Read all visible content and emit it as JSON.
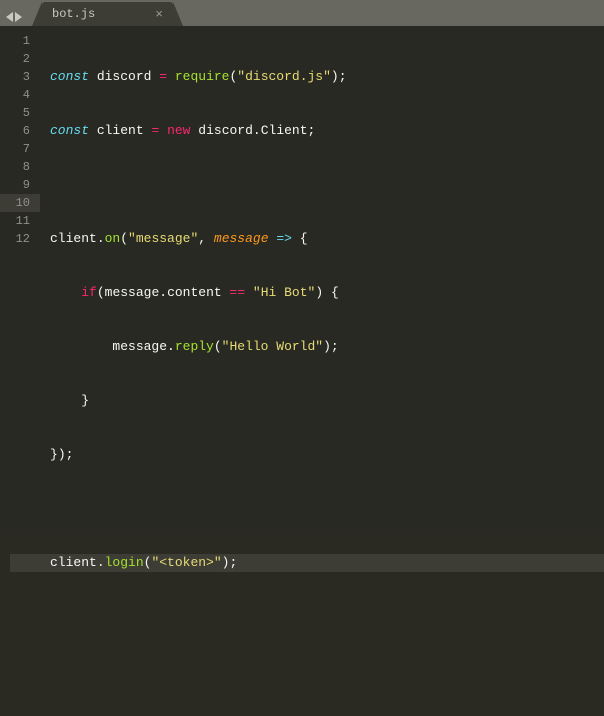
{
  "tab": {
    "title": "bot.js",
    "close_glyph": "×"
  },
  "line_count": 12,
  "current_line": 10,
  "code": {
    "l1": {
      "const": "const",
      "discord": "discord",
      "eq": "=",
      "require": "require",
      "p1": "(",
      "str": "\"discord.js\"",
      "p2": ")",
      "semi": ";"
    },
    "l2": {
      "const": "const",
      "client": "client",
      "eq": "=",
      "new": "new",
      "discord": "discord",
      "dot": ".",
      "Client": "Client",
      "semi": ";"
    },
    "l4": {
      "client": "client",
      "dot": ".",
      "on": "on",
      "p1": "(",
      "str": "\"message\"",
      "comma": ",",
      "msg": "message",
      "arrow": "=>",
      "brace": "{"
    },
    "l5": {
      "if": "if",
      "p1": "(",
      "msg": "message",
      "dot": ".",
      "content": "content",
      "eq": "==",
      "str": "\"Hi Bot\"",
      "p2": ")",
      "brace": "{"
    },
    "l6": {
      "msg": "message",
      "dot": ".",
      "reply": "reply",
      "p1": "(",
      "str": "\"Hello World\"",
      "p2": ")",
      "semi": ";"
    },
    "l7": {
      "brace": "}"
    },
    "l8": {
      "brace": "}",
      "p": ")",
      "semi": ";"
    },
    "l10": {
      "client": "client",
      "dot": ".",
      "login": "login",
      "p1": "(",
      "str": "\"<token>\"",
      "p2": ")",
      "semi": ";"
    }
  }
}
